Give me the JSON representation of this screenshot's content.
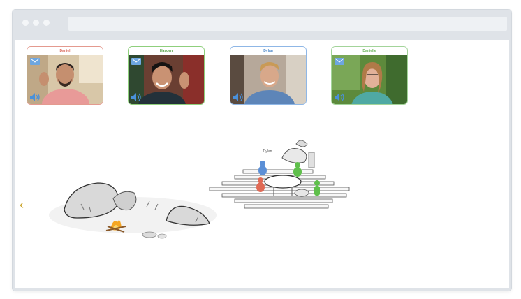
{
  "participants": [
    {
      "name": "Daniel",
      "color": "#e49a8f"
    },
    {
      "name": "Hayden",
      "color": "#8fcf7c"
    },
    {
      "name": "Dylan",
      "color": "#8fb7e6"
    },
    {
      "name": "Danielle",
      "color": "#a3d49a"
    }
  ],
  "scene": {
    "avatar_label": "Dylan"
  },
  "icons": {
    "chat": "chat-icon",
    "speaker": "speaker-icon",
    "back": "chevron-left-icon"
  }
}
